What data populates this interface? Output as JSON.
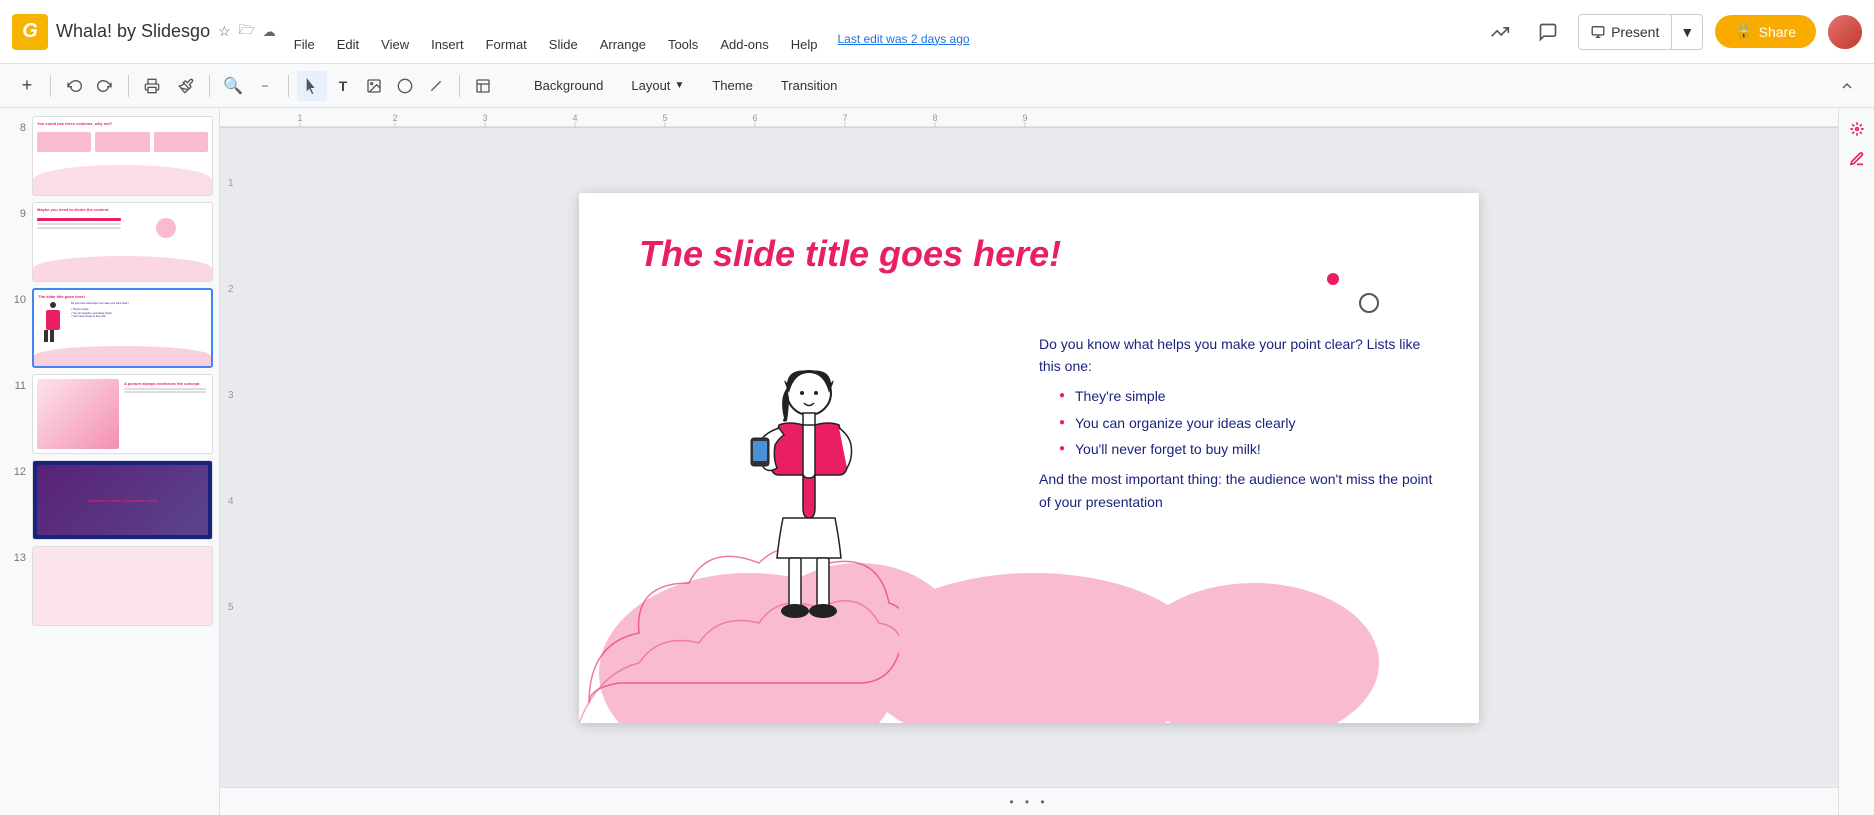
{
  "app": {
    "logo": "G",
    "title": "Whala! by Slidesgo",
    "last_edit": "Last edit was 2 days ago"
  },
  "menu": {
    "items": [
      "File",
      "Edit",
      "View",
      "Insert",
      "Format",
      "Slide",
      "Arrange",
      "Tools",
      "Add-ons",
      "Help"
    ]
  },
  "toolbar": {
    "background_label": "Background",
    "layout_label": "Layout",
    "theme_label": "Theme",
    "transition_label": "Transition"
  },
  "header": {
    "present_label": "Present",
    "share_label": "Share"
  },
  "slide": {
    "title": "The slide title goes here!",
    "text_intro": "Do you know what helps you make your point clear? Lists like this one:",
    "bullet1": "They're simple",
    "bullet2": "You can organize your ideas clearly",
    "bullet3": "You'll never forget to buy milk!",
    "text_conclusion": "And the most important thing: the audience won't miss the point of your presentation"
  },
  "slides_panel": {
    "slide8_num": "8",
    "slide9_num": "9",
    "slide10_num": "10",
    "slide11_num": "11",
    "slide12_num": "12",
    "slide13_num": "13",
    "slide8_title": "You could use three columns, why not?",
    "slide9_title": "Maybe you need to divide the content",
    "slide10_title": "The slide title goes here!",
    "slide11_title": "A picture always reinforces the concept",
    "slide12_title": "A picture is worth a thousand words"
  },
  "colors": {
    "accent": "#e91e63",
    "pink_light": "#f8bbd0",
    "navy": "#1a237e",
    "gold": "#F9AB00"
  },
  "icons": {
    "star": "☆",
    "folder": "📁",
    "cloud": "☁",
    "undo": "↩",
    "redo": "↪",
    "print": "🖨",
    "paint": "🎨",
    "zoom": "🔍",
    "cursor": "↖",
    "text": "T",
    "image": "🖼",
    "shape": "◯",
    "line": "/",
    "screen": "▣",
    "chevron_down": "▾",
    "chevron_up": "▴",
    "collapse": "▴",
    "present_icon": "▣",
    "lock": "🔒",
    "trending": "↗",
    "comment": "💬"
  },
  "bottom_bar": {
    "dots": "• • •"
  }
}
